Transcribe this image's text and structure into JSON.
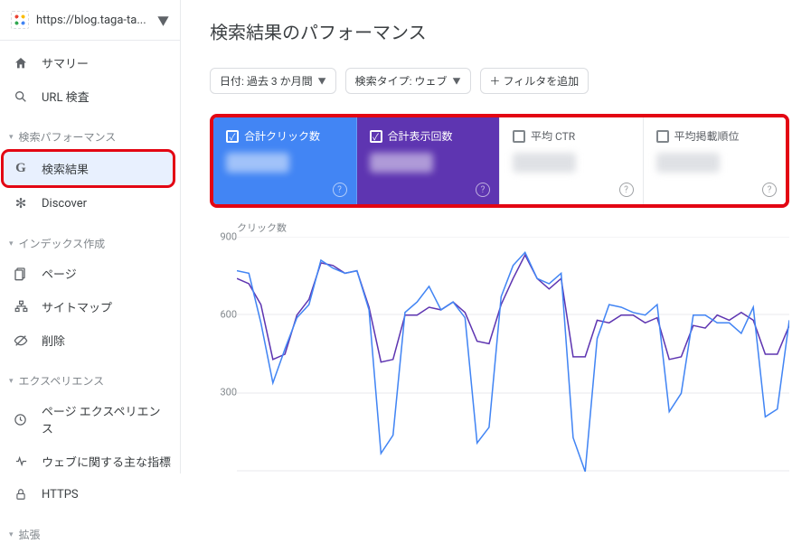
{
  "property": {
    "url": "https://blog.taga-ta..."
  },
  "nav": {
    "summary": "サマリー",
    "urlInspect": "URL 検査",
    "perfGroup": "検索パフォーマンス",
    "searchResults": "検索結果",
    "discover": "Discover",
    "indexGroup": "インデックス作成",
    "pages": "ページ",
    "sitemaps": "サイトマップ",
    "removals": "削除",
    "expGroup": "エクスペリエンス",
    "pageExp": "ページ エクスペリエンス",
    "webVitals": "ウェブに関する主な指標",
    "https": "HTTPS",
    "enhGroup": "拡張"
  },
  "page": {
    "title": "検索結果のパフォーマンス"
  },
  "filters": {
    "date": "日付: 過去 3 か月間",
    "type": "検索タイプ: ウェブ",
    "add": "＋ フィルタを追加"
  },
  "metrics": {
    "clicks": "合計クリック数",
    "impressions": "合計表示回数",
    "ctr": "平均 CTR",
    "position": "平均掲載順位"
  },
  "chart_data": {
    "type": "line",
    "title": "クリック数",
    "ylabel": "クリック数",
    "ylim": [
      0,
      900
    ],
    "yticks": [
      900,
      600,
      300
    ],
    "series": [
      {
        "name": "クリック数",
        "color": "#4285f4",
        "values": [
          770,
          760,
          570,
          340,
          470,
          590,
          640,
          810,
          780,
          760,
          770,
          620,
          70,
          140,
          610,
          650,
          710,
          620,
          650,
          590,
          110,
          170,
          670,
          790,
          840,
          740,
          720,
          760,
          130,
          0,
          510,
          640,
          630,
          610,
          600,
          640,
          230,
          300,
          600,
          600,
          570,
          570,
          530,
          630,
          210,
          240,
          580
        ]
      },
      {
        "name": "表示回数",
        "color": "#5e35b1",
        "values": [
          740,
          720,
          640,
          430,
          450,
          600,
          660,
          800,
          790,
          760,
          770,
          630,
          420,
          430,
          600,
          600,
          630,
          620,
          650,
          610,
          500,
          490,
          640,
          740,
          830,
          740,
          700,
          740,
          440,
          440,
          580,
          570,
          600,
          600,
          570,
          590,
          430,
          440,
          560,
          550,
          600,
          580,
          610,
          580,
          450,
          450,
          560
        ]
      }
    ]
  }
}
